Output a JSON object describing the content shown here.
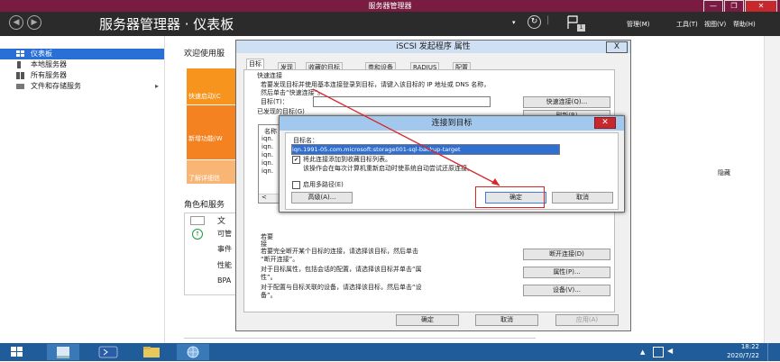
{
  "window": {
    "title": "服务器管理器",
    "minimize": "—",
    "restore": "❐",
    "close": "✕"
  },
  "header": {
    "back": "◀",
    "forward": "▶",
    "breadcrumb": "服务器管理器 · 仪表板",
    "notif_count": "1",
    "menus": [
      "管理(M)",
      "工具(T)",
      "视图(V)",
      "帮助(H)"
    ]
  },
  "sidebar": {
    "items": [
      {
        "label": "仪表板"
      },
      {
        "label": "本地服务器"
      },
      {
        "label": "所有服务器"
      },
      {
        "label": "文件和存储服务",
        "arrow": "▸"
      }
    ]
  },
  "main": {
    "welcome": "欢迎使用服",
    "quickstart": "快速启动(C",
    "newfeatures": "新增功能(W",
    "learnmore": "了解详细信",
    "roles_heading": "角色和服务",
    "role_name": "文",
    "role_lines": [
      "可管",
      "事件",
      "性能",
      "BPA"
    ],
    "hide": "隐藏",
    "count": "1"
  },
  "iscsi": {
    "title": "iSCSI 发起程序 属性",
    "close": "X",
    "tabs": [
      "目标",
      "发现",
      "收藏的目标",
      "卷和设备",
      "RADIUS",
      "配置"
    ],
    "quickconnect_label": "快速连接",
    "quickconnect_text1": "若要发现目标并使用基本连接登录到目标，请键入该目标的 IP 地址或 DNS 名称，",
    "quickconnect_text2": "然后单击“快速连接”。",
    "target_label": "目标(T)：",
    "quickconnect_btn": "快速连接(Q)...",
    "discovered_label": "已发现的目标(G)",
    "refresh_btn": "刷新(R)",
    "list_header": "名称",
    "list_rows": [
      "iqn.",
      "iqn.",
      "iqn.",
      "iqn.",
      "iqn."
    ],
    "status_header": "状态",
    "scroll_left": "<",
    "connect_text1": "若要",
    "connect_text2": "接",
    "disconnect_text1": "若要完全断开某个目标的连接，请选择该目标，然后单击",
    "disconnect_text2": "“断开连接”。",
    "disconnect_btn": "断开连接(D)",
    "properties_text1": "对于目标属性，包括会话的配置，请选择该目标并单击“属",
    "properties_text2": "性”。",
    "properties_btn": "属性(P)...",
    "devices_text1": "对于配置与目标关联的设备，请选择该目标，然后单击“设",
    "devices_text2": "备”。",
    "devices_btn": "设备(V)...",
    "ok": "确定",
    "cancel": "取消",
    "apply": "应用(A)"
  },
  "connect": {
    "title": "连接到目标",
    "close": "✕",
    "target_name_label": "目标名：",
    "target_name_value": "iqn.1991-05.com.microsoft:storage001-sql-backup-target",
    "favorite_checkbox": "✔",
    "favorite_label": "将此连接添加到收藏目标列表。",
    "favorite_note": "该操作会在每次计算机重新启动时使系统自动尝试还原连接。",
    "multipath_label": "启用多路径(E)",
    "advanced_btn": "高级(A)...",
    "ok": "确定",
    "cancel": "取消"
  },
  "taskbar": {
    "time": "18:22",
    "date": "2020/7/22"
  },
  "colors": {
    "titlebar": "#7a1c42",
    "header": "#2b2b2b",
    "accent_orange": "#f58220",
    "selection": "#2a6fd6",
    "annotation": "#d9252a"
  }
}
